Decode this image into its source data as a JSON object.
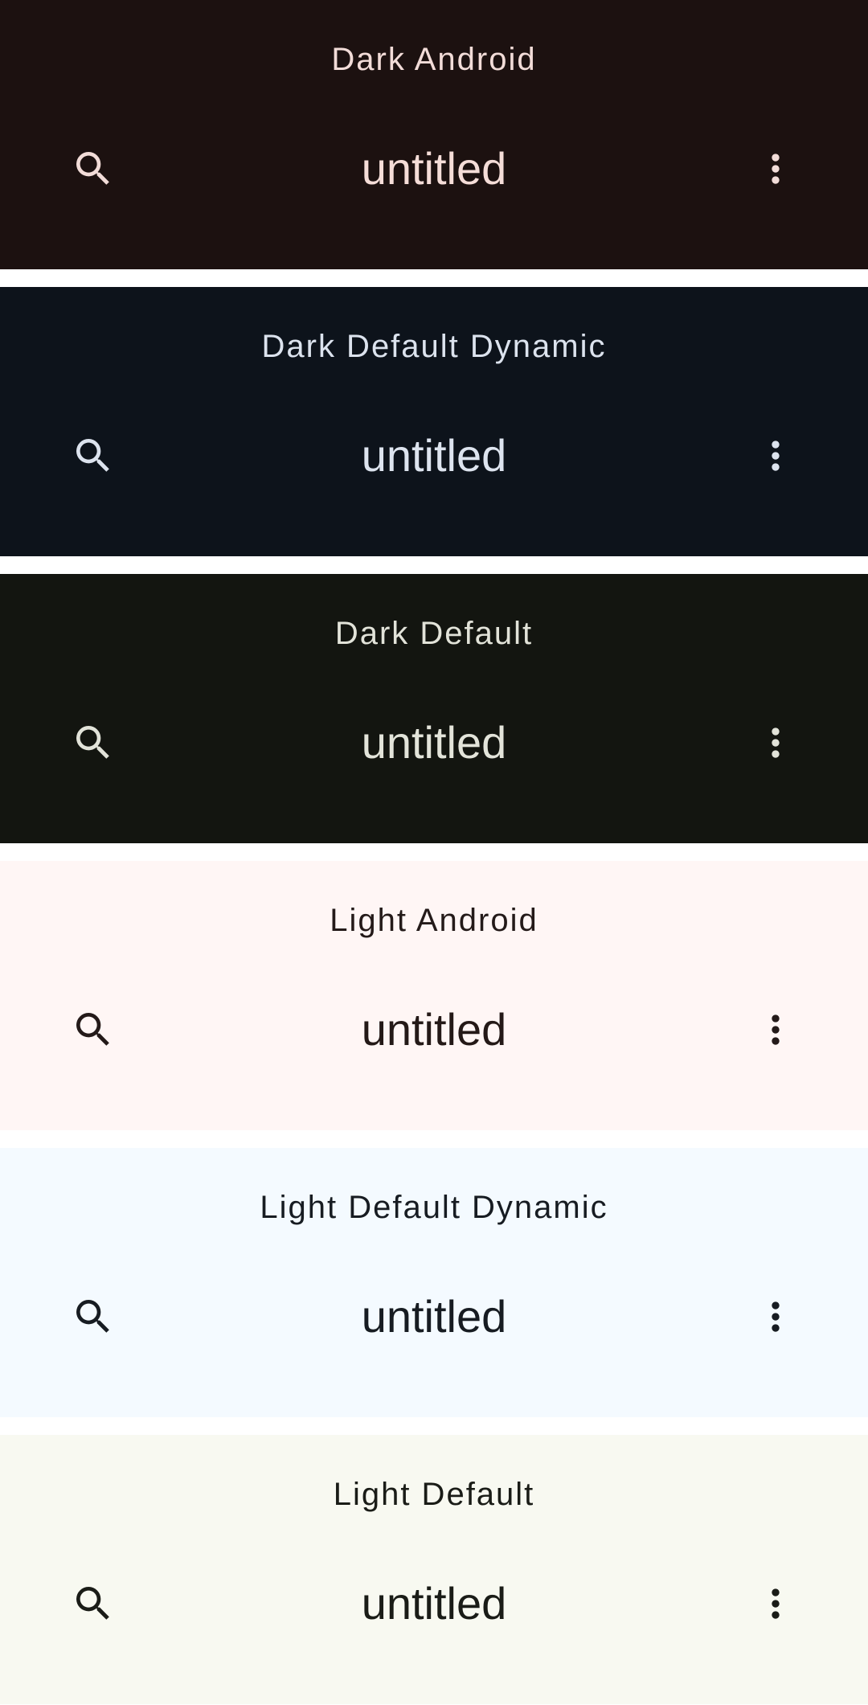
{
  "panels": [
    {
      "label": "Dark Android",
      "title": "untitled",
      "colors": {
        "background": "#1c1110",
        "label": "#f2dcd8",
        "title": "#f5ddd8",
        "icon": "#f2dcd8"
      },
      "icons": {
        "left": "search-icon",
        "right": "more-vert-icon"
      }
    },
    {
      "label": "Dark Default Dynamic",
      "title": "untitled",
      "colors": {
        "background": "#0d131b",
        "label": "#dce3ee",
        "title": "#dde4ef",
        "icon": "#dce3ee"
      },
      "icons": {
        "left": "search-icon",
        "right": "more-vert-icon"
      }
    },
    {
      "label": "Dark Default",
      "title": "untitled",
      "colors": {
        "background": "#131510",
        "label": "#e2e3d9",
        "title": "#e3e4da",
        "icon": "#e2e3d9"
      },
      "icons": {
        "left": "search-icon",
        "right": "more-vert-icon"
      }
    },
    {
      "label": "Light Android",
      "title": "untitled",
      "colors": {
        "background": "#fff6f5",
        "label": "#241a19",
        "title": "#241917",
        "icon": "#241a19"
      },
      "icons": {
        "left": "search-icon",
        "right": "more-vert-icon"
      }
    },
    {
      "label": "Light Default Dynamic",
      "title": "untitled",
      "colors": {
        "background": "#f4faff",
        "label": "#171c22",
        "title": "#171c22",
        "icon": "#171c22"
      },
      "icons": {
        "left": "search-icon",
        "right": "more-vert-icon"
      }
    },
    {
      "label": "Light Default",
      "title": "untitled",
      "colors": {
        "background": "#f8f9f1",
        "label": "#1a1c17",
        "title": "#1a1c17",
        "icon": "#1a1c17"
      },
      "icons": {
        "left": "search-icon",
        "right": "more-vert-icon"
      }
    }
  ]
}
